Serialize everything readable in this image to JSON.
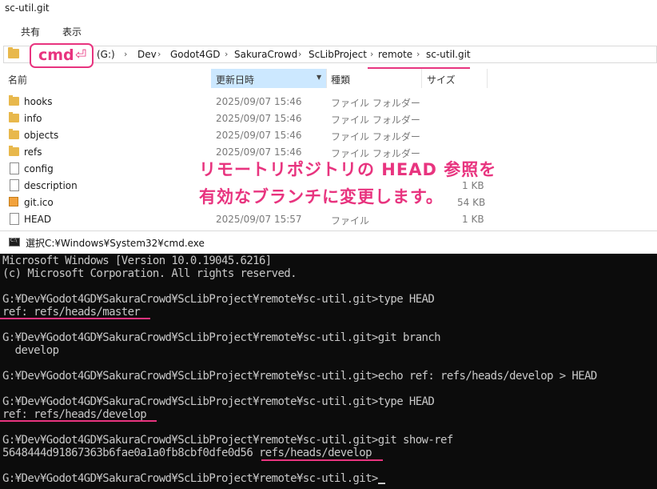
{
  "explorer": {
    "title": "sc-util.git",
    "ribbon_tabs": [
      "共有",
      "表示"
    ],
    "breadcrumb": [
      "(G:)",
      "Dev",
      "Godot4GD",
      "SakuraCrowd",
      "ScLibProject",
      "remote",
      "sc-util.git"
    ],
    "columns": {
      "name": "名前",
      "date": "更新日時",
      "type": "種類",
      "size": "サイズ"
    },
    "files": [
      {
        "name": "hooks",
        "date": "2025/09/07 15:46",
        "type": "ファイル フォルダー",
        "size": "",
        "icon": "folder-icon"
      },
      {
        "name": "info",
        "date": "2025/09/07 15:46",
        "type": "ファイル フォルダー",
        "size": "",
        "icon": "folder-icon"
      },
      {
        "name": "objects",
        "date": "2025/09/07 15:46",
        "type": "ファイル フォルダー",
        "size": "",
        "icon": "folder-icon"
      },
      {
        "name": "refs",
        "date": "2025/09/07 15:46",
        "type": "ファイル フォルダー",
        "size": "",
        "icon": "folder-icon"
      },
      {
        "name": "config",
        "date": "",
        "type": "",
        "size": "",
        "icon": "file-icon"
      },
      {
        "name": "description",
        "date": "",
        "type": "",
        "size": "1 KB",
        "icon": "file-icon"
      },
      {
        "name": "git.ico",
        "date": "",
        "type": "",
        "size": "54 KB",
        "icon": "ico-file-icon"
      },
      {
        "name": "HEAD",
        "date": "2025/09/07 15:57",
        "type": "ファイル",
        "size": "1 KB",
        "icon": "file-icon"
      }
    ]
  },
  "annotation": {
    "cmd_label": "cmd",
    "enter_symbol": "⏎",
    "line1": "リモートリポジトリの HEAD 参照を",
    "line2": "有効なブランチに変更します。",
    "color": "#e8347f"
  },
  "cmd": {
    "title": "選択C:¥Windows¥System32¥cmd.exe",
    "lines": [
      "Microsoft Windows [Version 10.0.19045.6216]",
      "(c) Microsoft Corporation. All rights reserved.",
      "",
      "G:¥Dev¥Godot4GD¥SakuraCrowd¥ScLibProject¥remote¥sc-util.git>type HEAD",
      "ref: refs/heads/master",
      "",
      "G:¥Dev¥Godot4GD¥SakuraCrowd¥ScLibProject¥remote¥sc-util.git>git branch",
      "  develop",
      "",
      "G:¥Dev¥Godot4GD¥SakuraCrowd¥ScLibProject¥remote¥sc-util.git>echo ref: refs/heads/develop > HEAD",
      "",
      "G:¥Dev¥Godot4GD¥SakuraCrowd¥ScLibProject¥remote¥sc-util.git>type HEAD",
      "ref: refs/heads/develop",
      "",
      "G:¥Dev¥Godot4GD¥SakuraCrowd¥ScLibProject¥remote¥sc-util.git>git show-ref",
      "5648444d91867363b6fae0a1a0fb8cbf0dfe0d56 refs/heads/develop",
      "",
      "G:¥Dev¥Godot4GD¥SakuraCrowd¥ScLibProject¥remote¥sc-util.git>"
    ]
  }
}
